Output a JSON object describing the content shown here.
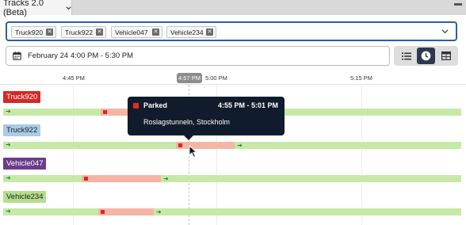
{
  "tab": {
    "title": "Tracks 2.0 (Beta)"
  },
  "vehicle_select": {
    "chips": [
      "Truck920",
      "Truck922",
      "Vehicle047",
      "Vehicle234"
    ]
  },
  "date_range": {
    "value": "February 24 4:00 PM - 5:30 PM"
  },
  "timeline": {
    "ticks": [
      "4:45 PM",
      "5:00 PM",
      "5:15 PM"
    ],
    "now": "4:57 PM"
  },
  "vehicles": [
    {
      "name": "Truck920",
      "color": "#d12a26",
      "text_color": "#ffffff"
    },
    {
      "name": "Truck922",
      "color": "#a9cbe6",
      "text_color": "#222222"
    },
    {
      "name": "Vehicle047",
      "color": "#6c3c8c",
      "text_color": "#ffffff"
    },
    {
      "name": "Vehicle234",
      "color": "#b4de8e",
      "text_color": "#222222"
    }
  ],
  "tooltip": {
    "status": "Parked",
    "time_range": "4:55 PM - 5:01 PM",
    "location": "Roslagstunneln, Stockholm"
  },
  "colors": {
    "driving": "#c7e9a8",
    "parked": "#f5b5a5",
    "accent": "#2a5fa8"
  }
}
